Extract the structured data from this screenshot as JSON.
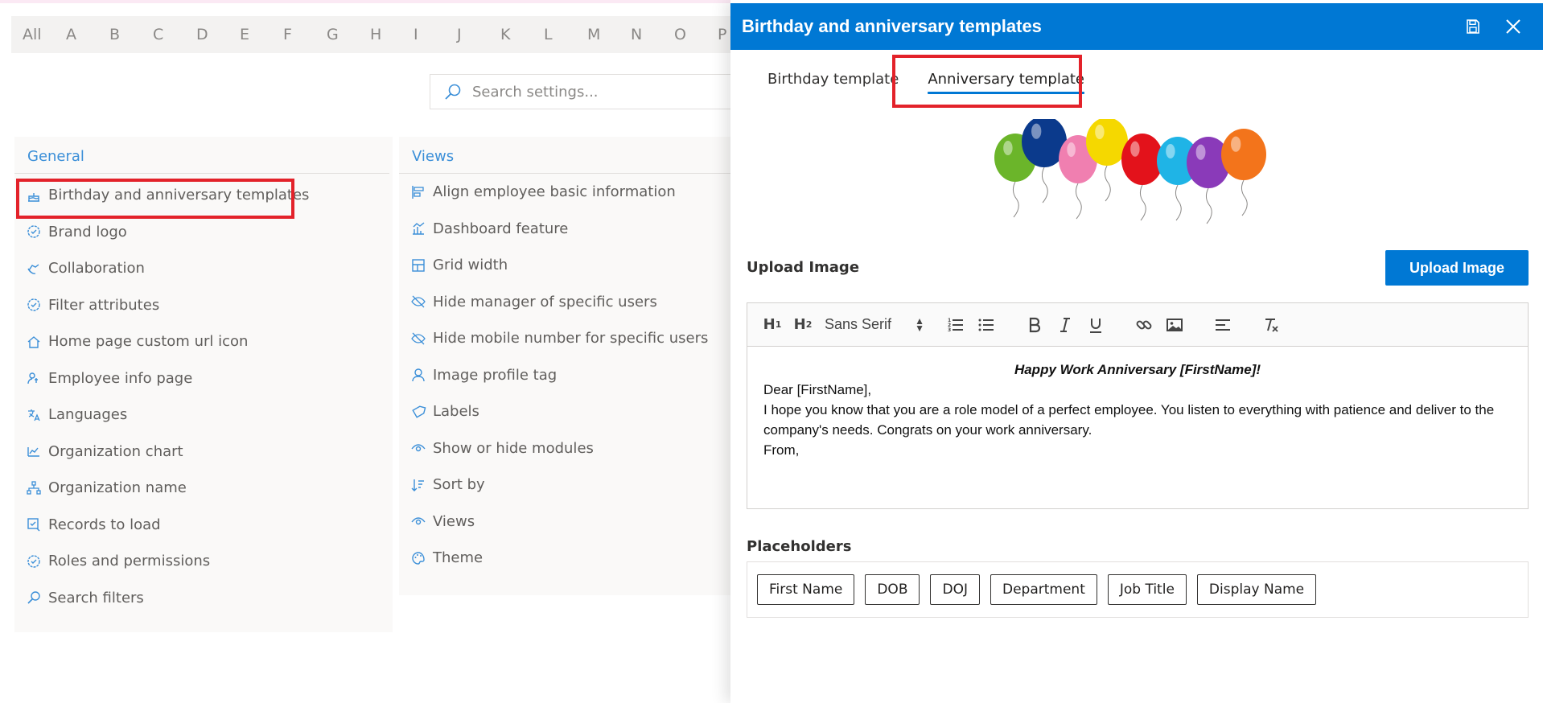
{
  "alphabet": [
    "All",
    "A",
    "B",
    "C",
    "D",
    "E",
    "F",
    "G",
    "H",
    "I",
    "J",
    "K",
    "L",
    "M",
    "N",
    "O",
    "P"
  ],
  "search": {
    "placeholder": "Search settings..."
  },
  "general": {
    "title": "General",
    "items": [
      {
        "label": "Birthday and anniversary templates",
        "icon": "cake-icon"
      },
      {
        "label": "Brand logo",
        "icon": "badge-icon"
      },
      {
        "label": "Collaboration",
        "icon": "collaboration-icon"
      },
      {
        "label": "Filter attributes",
        "icon": "badge-icon"
      },
      {
        "label": "Home page custom url icon",
        "icon": "home-icon"
      },
      {
        "label": "Employee info page",
        "icon": "person-info-icon"
      },
      {
        "label": "Languages",
        "icon": "languages-icon"
      },
      {
        "label": "Organization chart",
        "icon": "org-chart-icon"
      },
      {
        "label": "Organization name",
        "icon": "org-name-icon"
      },
      {
        "label": "Records to load",
        "icon": "records-icon"
      },
      {
        "label": "Roles and permissions",
        "icon": "badge-icon"
      },
      {
        "label": "Search filters",
        "icon": "search-icon"
      }
    ]
  },
  "views": {
    "title": "Views",
    "items": [
      {
        "label": "Align employee basic information",
        "icon": "align-icon"
      },
      {
        "label": "Dashboard feature",
        "icon": "dashboard-icon"
      },
      {
        "label": "Grid width",
        "icon": "grid-icon"
      },
      {
        "label": "Hide manager of specific users",
        "icon": "hide-icon"
      },
      {
        "label": "Hide mobile number for specific users",
        "icon": "hide-icon"
      },
      {
        "label": "Image profile tag",
        "icon": "person-icon"
      },
      {
        "label": "Labels",
        "icon": "tag-icon"
      },
      {
        "label": "Show or hide modules",
        "icon": "eye-icon"
      },
      {
        "label": "Sort by",
        "icon": "sort-icon"
      },
      {
        "label": "Views",
        "icon": "eye-icon"
      },
      {
        "label": "Theme",
        "icon": "palette-icon"
      }
    ]
  },
  "panel": {
    "title": "Birthday and anniversary templates",
    "tabs": [
      {
        "label": "Birthday template",
        "active": false
      },
      {
        "label": "Anniversary template",
        "active": true
      }
    ],
    "upload_label": "Upload Image",
    "upload_button": "Upload Image",
    "editor": {
      "font": "Sans Serif",
      "heading": "Happy Work Anniversary [FirstName]!",
      "lines": [
        "Dear [FirstName],",
        "I hope you know that you are a role model of a perfect employee. You listen to everything with patience and deliver to the company's needs. Congrats on your work anniversary.",
        "From,"
      ]
    },
    "placeholders_label": "Placeholders",
    "placeholders": [
      "First Name",
      "DOB",
      "DOJ",
      "Department",
      "Job Title",
      "Display Name"
    ]
  },
  "colors": {
    "accent": "#0078d4",
    "link": "#3b8fd8",
    "highlight": "#e3222a",
    "balloons": [
      "#6bb52a",
      "#0b3a8c",
      "#f07fb0",
      "#f5d800",
      "#e3121b",
      "#1fb4e6",
      "#8a3ab9",
      "#f3741b"
    ]
  }
}
